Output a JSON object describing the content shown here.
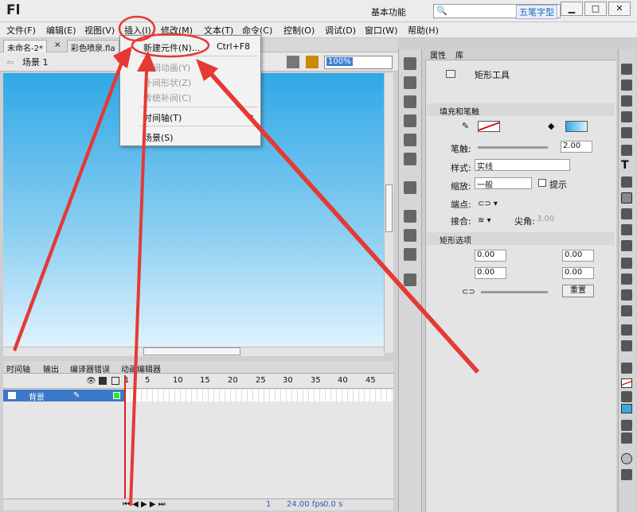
{
  "app": {
    "logo": "Fl",
    "workspace": "基本功能",
    "workspace_arrow": "▾",
    "watermark": "五笔字型"
  },
  "window_controls": [
    "▁",
    "□",
    "✕"
  ],
  "menus": [
    "文件(F)",
    "编辑(E)",
    "视图(V)",
    "插入(I)",
    "修改(M)",
    "文本(T)",
    "命令(C)",
    "控制(O)",
    "调试(D)",
    "窗口(W)",
    "帮助(H)"
  ],
  "doc_tabs": [
    "未命名-2*",
    "×",
    "彩色喷泉.fla"
  ],
  "scene": {
    "label": "场景 1",
    "zoom": "100%"
  },
  "insert_menu": {
    "items": [
      {
        "label": "新建元件(N)...",
        "shortcut": "Ctrl+F8",
        "enabled": true
      },
      {
        "label": "补间动画(Y)",
        "enabled": false
      },
      {
        "label": "补间形状(Z)",
        "enabled": false
      },
      {
        "label": "传统补间(C)",
        "enabled": false
      },
      {
        "label": "时间轴(T)",
        "enabled": true,
        "submenu": "▶"
      },
      {
        "label": "场景(S)",
        "enabled": true
      }
    ]
  },
  "timeline": {
    "tabs": [
      "时间轴",
      "输出",
      "编译器错误",
      "动画编辑器"
    ],
    "frame_numbers": [
      "1",
      "5",
      "10",
      "15",
      "20",
      "25",
      "30",
      "35",
      "40",
      "45"
    ],
    "layer": "背景",
    "status": {
      "frame": "1",
      "fps": "24.00 fps",
      "time": "0.0 s"
    }
  },
  "properties": {
    "tabs": [
      "属性",
      "库"
    ],
    "tool_name": "矩形工具",
    "section_fill": "填充和笔触",
    "stroke_label": "笔触:",
    "stroke_value": "2.00",
    "style_label": "样式:",
    "style_value": "实线",
    "scale_label": "缩放:",
    "scale_value": "一般",
    "hint_label": "提示",
    "cap_label": "端点:",
    "join_label": "接合:",
    "miter_label": "尖角:",
    "miter_value": "3.00",
    "section_rect": "矩形选项",
    "corners": [
      "0.00",
      "0.00",
      "0.00",
      "0.00"
    ],
    "reset": "重置"
  },
  "colors": {
    "accent": "#3d7fd6",
    "annotation": "#e53935"
  }
}
